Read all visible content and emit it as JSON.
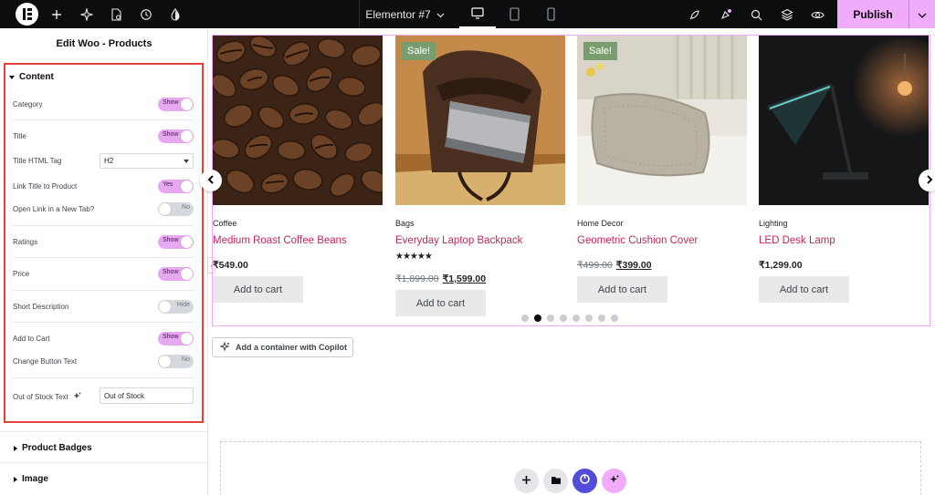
{
  "topbar": {
    "document_title": "Elementor #7",
    "publish_label": "Publish",
    "icons": {
      "logo": "elementor-logo",
      "add": "plus-icon",
      "structure": "sparkle-icon",
      "page_settings": "page-settings-icon",
      "history": "history-icon",
      "theme": "drop-icon",
      "devices": [
        "desktop-icon",
        "tablet-icon",
        "mobile-icon"
      ],
      "right": [
        "rocket-icon",
        "notification-icon",
        "search-icon",
        "layers-icon",
        "eye-icon"
      ]
    },
    "accent": "#f0abfc"
  },
  "panel": {
    "header": "Edit Woo - Products",
    "content_section": {
      "title": "Content",
      "rows": [
        {
          "label": "Category",
          "type": "toggle",
          "state": "on",
          "text": "Show"
        },
        {
          "label": "Title",
          "type": "toggle",
          "state": "on",
          "text": "Show"
        },
        {
          "label": "Title HTML Tag",
          "type": "select",
          "value": "H2"
        },
        {
          "label": "Link Title to Product",
          "type": "toggle",
          "state": "on",
          "text": "Yes"
        },
        {
          "label": "Open Link in a New Tab?",
          "type": "toggle",
          "state": "off",
          "text": "No"
        },
        {
          "label": "Ratings",
          "type": "toggle",
          "state": "on",
          "text": "Show"
        },
        {
          "label": "Price",
          "type": "toggle",
          "state": "on",
          "text": "Show"
        },
        {
          "label": "Short Description",
          "type": "toggle",
          "state": "off",
          "text": "Hide"
        },
        {
          "label": "Add to Cart",
          "type": "toggle",
          "state": "on",
          "text": "Show"
        },
        {
          "label": "Change Button Text",
          "type": "toggle",
          "state": "off",
          "text": "No"
        },
        {
          "label": "Out of Stock Text",
          "type": "text",
          "value": "Out of Stock"
        }
      ]
    },
    "collapsed_sections": [
      "Product Badges",
      "Image"
    ],
    "highlight_color": "#e0433a"
  },
  "products": [
    {
      "category": "Coffee",
      "title": "Medium Roast Coffee Beans",
      "sale": false,
      "sale_label": "",
      "rating": "",
      "price": "₹549.00",
      "old_price": "",
      "button": "Add to cart",
      "image": "coffee-beans"
    },
    {
      "category": "Bags",
      "title": "Everyday Laptop Backpack",
      "sale": true,
      "sale_label": "Sale!",
      "rating": "★★★★★",
      "price": "₹1,599.00",
      "old_price": "₹1,899.00",
      "button": "Add to cart",
      "image": "laptop-backpack"
    },
    {
      "category": "Home Decor",
      "title": "Geometric Cushion Cover",
      "sale": true,
      "sale_label": "Sale!",
      "rating": "",
      "price": "₹399.00",
      "old_price": "₹499.00",
      "button": "Add to cart",
      "image": "cushion"
    },
    {
      "category": "Lighting",
      "title": "LED Desk Lamp",
      "sale": false,
      "sale_label": "",
      "rating": "",
      "price": "₹1,299.00",
      "old_price": "",
      "button": "Add to cart",
      "image": "desk-lamp"
    }
  ],
  "carousel": {
    "dot_count": 8,
    "active_dot": 2
  },
  "canvas": {
    "copilot_label": "Add a container with Copilot",
    "title_color": "#c0285f"
  }
}
